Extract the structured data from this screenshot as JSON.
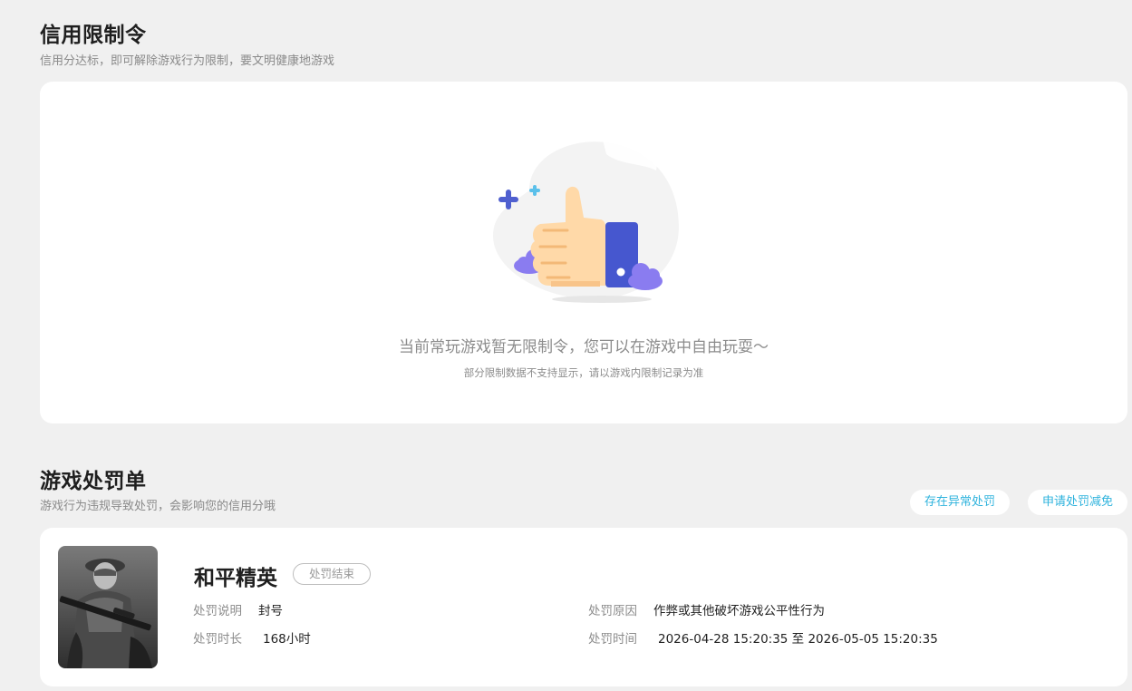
{
  "restriction": {
    "title": "信用限制令",
    "subtitle": "信用分达标，即可解除游戏行为限制，要文明健康地游戏",
    "empty_message": "当前常玩游戏暂无限制令，您可以在游戏中自由玩耍～",
    "empty_note": "部分限制数据不支持显示，请以游戏内限制记录为准"
  },
  "penalty": {
    "title": "游戏处罚单",
    "subtitle": "游戏行为违规导致处罚，会影响您的信用分哦",
    "actions": {
      "abnormal": "存在异常处罚",
      "reduce": "申请处罚减免"
    },
    "item": {
      "game_name": "和平精英",
      "status": "处罚结束",
      "desc_label": "处罚说明",
      "desc_value": "封号",
      "duration_label": "处罚时长",
      "duration_value": "168小时",
      "reason_label": "处罚原因",
      "reason_value": "作弊或其他破坏游戏公平性行为",
      "time_label": "处罚时间",
      "time_value": "2026-04-28 15:20:35 至 2026-05-05 15:20:35"
    }
  },
  "colors": {
    "accent": "#2fb3dd",
    "thumb_blue": "#4657cf",
    "hand": "#ffd9a8",
    "cloud": "#8a7cf0"
  }
}
